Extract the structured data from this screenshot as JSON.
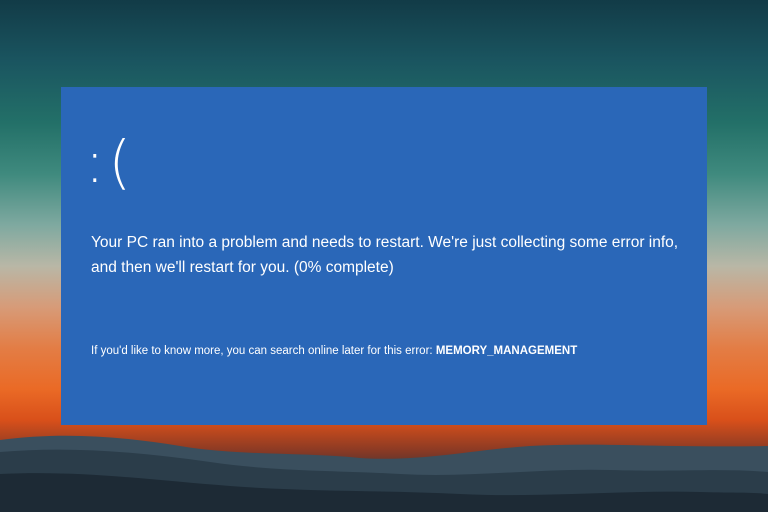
{
  "bsod": {
    "sad_face": ":(",
    "message": "Your PC ran into a problem and needs to restart. We're just collecting some error info, and then we'll restart for you. (0% complete)",
    "progress_percent": 0,
    "more_info_prefix": "If you'd like to know more, you can search online later for this error: ",
    "stop_code": "MEMORY_MANAGEMENT"
  },
  "colors": {
    "bsod_background": "#2a67b8",
    "text": "#ffffff"
  }
}
